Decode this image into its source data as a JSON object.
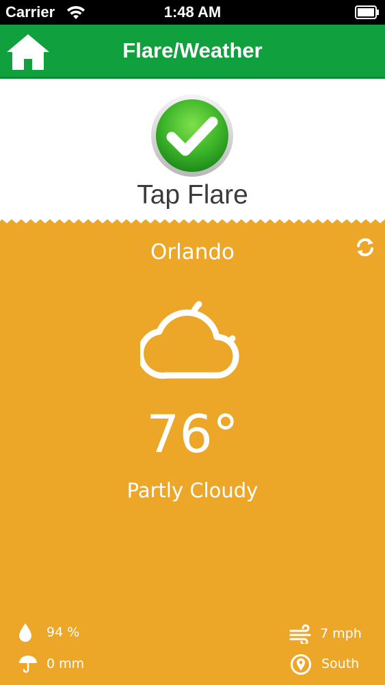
{
  "status_bar": {
    "carrier": "Carrier",
    "time": "1:48 AM"
  },
  "nav": {
    "title": "Flare/Weather",
    "home_icon": "home-icon"
  },
  "flare": {
    "label": "Tap Flare",
    "icon": "checkmark-icon"
  },
  "weather": {
    "city": "Orlando",
    "temperature": "76°",
    "condition": "Partly Cloudy",
    "icon": "partly-cloudy-night-icon",
    "stats": {
      "humidity": "94 %",
      "precipitation": "0 mm",
      "wind_speed": "7 mph",
      "wind_direction": "South"
    }
  },
  "colors": {
    "nav_green": "#10A13E",
    "weather_orange": "#EDA728",
    "label_gray": "#3b3b3b"
  }
}
